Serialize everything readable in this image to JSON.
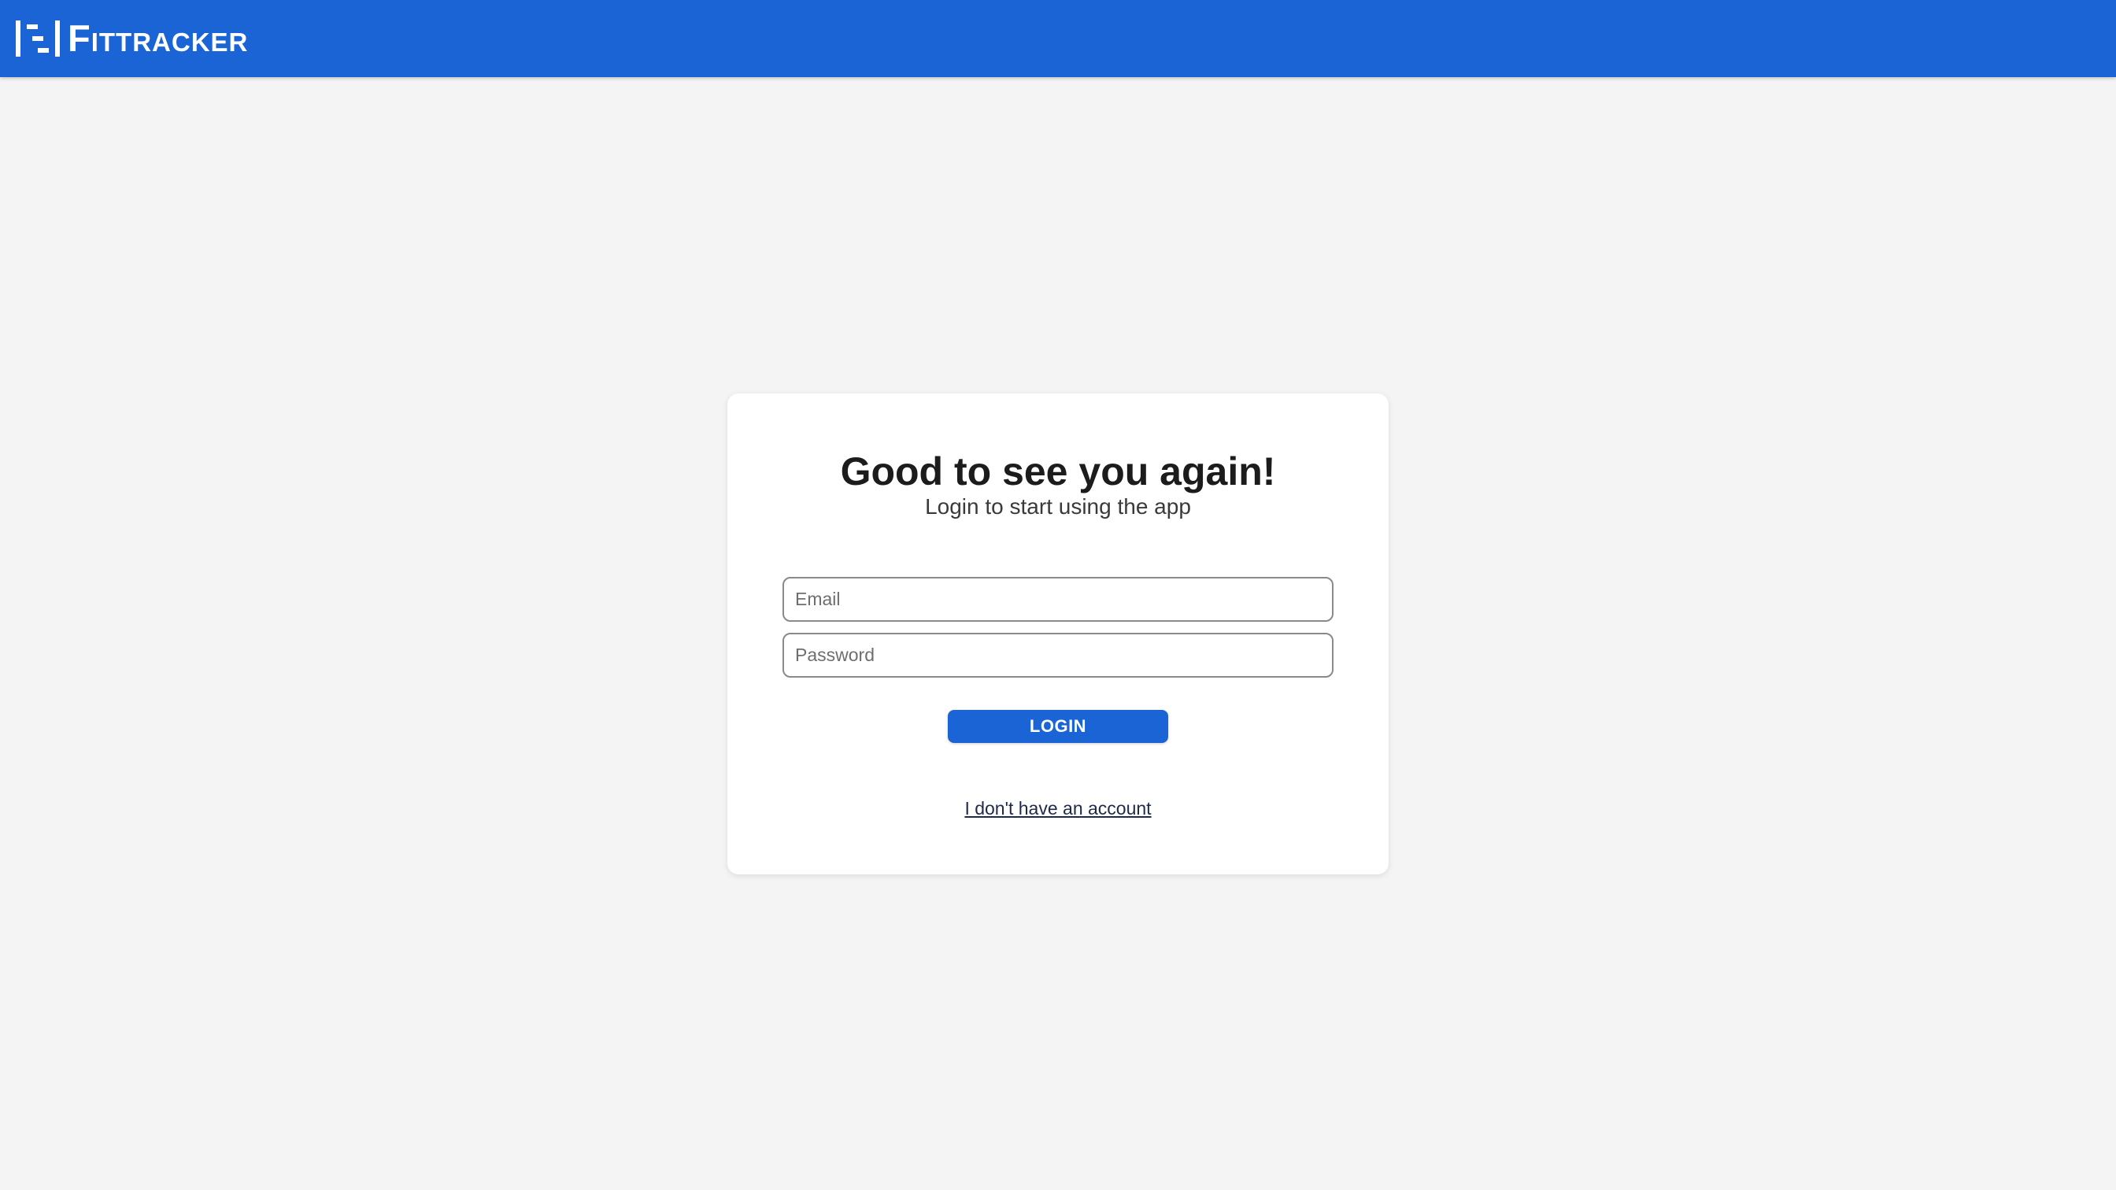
{
  "header": {
    "brand_name": "FitTracker",
    "logo_icon": "fittracker-logo-icon",
    "background_color": "#1a64d6"
  },
  "login_card": {
    "title": "Good to see you again!",
    "subtitle": "Login to start using the app",
    "email": {
      "placeholder": "Email",
      "value": ""
    },
    "password": {
      "placeholder": "Password",
      "value": ""
    },
    "login_button_label": "LOGIN",
    "signup_link_label": "I don't have an account"
  },
  "colors": {
    "accent": "#1a64d6",
    "page_background": "#f4f4f4",
    "card_background": "#ffffff"
  }
}
